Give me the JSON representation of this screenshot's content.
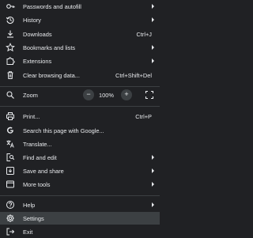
{
  "menu": {
    "items": [
      {
        "id": "passwords",
        "label": "Passwords and autofill",
        "icon": "key-icon",
        "submenu": true
      },
      {
        "id": "history",
        "label": "History",
        "icon": "history-icon",
        "submenu": true
      },
      {
        "id": "downloads",
        "label": "Downloads",
        "icon": "download-icon",
        "shortcut": "Ctrl+J"
      },
      {
        "id": "bookmarks",
        "label": "Bookmarks and lists",
        "icon": "star-icon",
        "submenu": true
      },
      {
        "id": "extensions",
        "label": "Extensions",
        "icon": "puzzle-icon",
        "submenu": true
      },
      {
        "id": "clear",
        "label": "Clear browsing data...",
        "icon": "trash-icon",
        "shortcut": "Ctrl+Shift+Del"
      },
      {
        "id": "print",
        "label": "Print...",
        "icon": "printer-icon",
        "shortcut": "Ctrl+P"
      },
      {
        "id": "search",
        "label": "Search this page with Google...",
        "icon": "google-icon"
      },
      {
        "id": "translate",
        "label": "Translate...",
        "icon": "translate-icon"
      },
      {
        "id": "find",
        "label": "Find and edit",
        "icon": "find-icon",
        "submenu": true
      },
      {
        "id": "save",
        "label": "Save and share",
        "icon": "save-icon",
        "submenu": true
      },
      {
        "id": "more",
        "label": "More tools",
        "icon": "tools-icon",
        "submenu": true
      },
      {
        "id": "help",
        "label": "Help",
        "icon": "help-icon",
        "submenu": true
      },
      {
        "id": "settings",
        "label": "Settings",
        "icon": "gear-icon",
        "highlighted": true
      },
      {
        "id": "exit",
        "label": "Exit",
        "icon": "exit-icon"
      }
    ],
    "zoom": {
      "label": "Zoom",
      "value": "100%",
      "minus": "−",
      "plus": "+",
      "icon": "zoom-icon",
      "fullscreen_icon": "fullscreen-icon"
    }
  },
  "colors": {
    "background": "#202124",
    "text": "#e8eaed",
    "hover": "#3c4043",
    "divider": "#3c4043"
  }
}
